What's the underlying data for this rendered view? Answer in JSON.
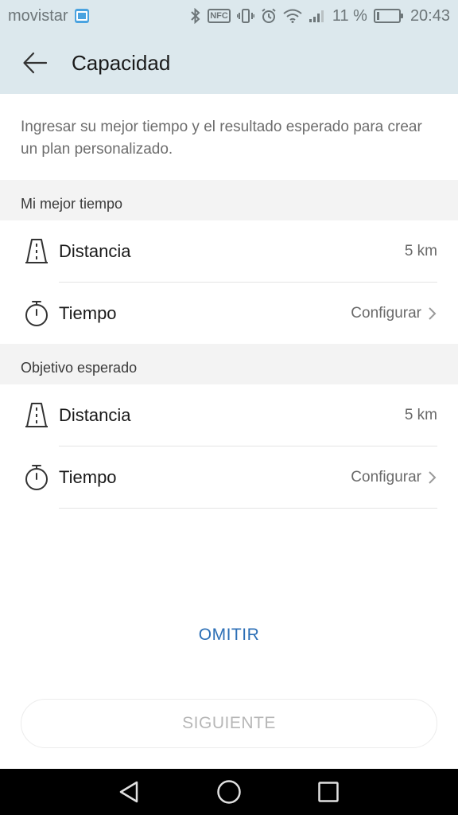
{
  "status_bar": {
    "carrier": "movistar",
    "nfc": "NFC",
    "battery_text": "11 %",
    "battery_level": 0.11,
    "time": "20:43"
  },
  "app_bar": {
    "back_icon": "arrow-left-icon",
    "title": "Capacidad"
  },
  "intro": {
    "text": "Ingresar su mejor tiempo y el resultado esperado para crear un plan personalizado."
  },
  "sections": [
    {
      "header": "Mi mejor tiempo",
      "rows": [
        {
          "icon": "road-icon",
          "label": "Distancia",
          "value": "5 km"
        },
        {
          "icon": "stopwatch-icon",
          "label": "Tiempo",
          "value": "Configurar"
        }
      ]
    },
    {
      "header": "Objetivo esperado",
      "rows": [
        {
          "icon": "road-icon",
          "label": "Distancia",
          "value": "5 km"
        },
        {
          "icon": "stopwatch-icon",
          "label": "Tiempo",
          "value": "Configurar"
        }
      ]
    }
  ],
  "actions": {
    "omit_label": "OMITIR",
    "next_label": "SIGUIENTE"
  },
  "colors": {
    "app_bar_bg": "#dce8ed",
    "accent": "#2c6fb6",
    "disabled_text": "#b7b7b7"
  }
}
